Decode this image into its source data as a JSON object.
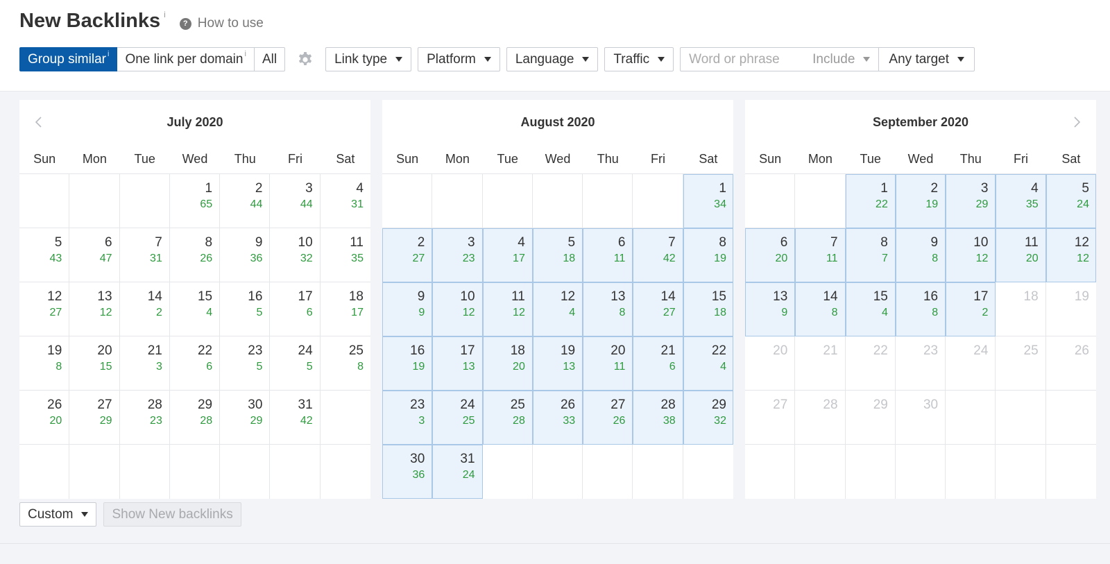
{
  "header": {
    "title": "New Backlinks",
    "title_info": "i",
    "how_to_icon": "question-circle-icon",
    "how_to_label": "How to use"
  },
  "toolbar": {
    "grouping": [
      {
        "label": "Group similar",
        "info": "i",
        "active": true
      },
      {
        "label": "One link per domain",
        "info": "i",
        "active": false
      },
      {
        "label": "All",
        "info": "",
        "active": false
      }
    ],
    "settings_icon": "gear-icon",
    "filters": [
      "Link type",
      "Platform",
      "Language",
      "Traffic"
    ],
    "search_placeholder": "Word or phrase",
    "include_label": "Include",
    "target_label": "Any target"
  },
  "weekdays": [
    "Sun",
    "Mon",
    "Tue",
    "Wed",
    "Thu",
    "Fri",
    "Sat"
  ],
  "calendars": [
    {
      "month": "July 2020",
      "nav": "prev",
      "weeks": [
        [
          null,
          null,
          null,
          {
            "d": "1",
            "c": "65"
          },
          {
            "d": "2",
            "c": "44"
          },
          {
            "d": "3",
            "c": "44"
          },
          {
            "d": "4",
            "c": "31"
          }
        ],
        [
          {
            "d": "5",
            "c": "43"
          },
          {
            "d": "6",
            "c": "47"
          },
          {
            "d": "7",
            "c": "31"
          },
          {
            "d": "8",
            "c": "26"
          },
          {
            "d": "9",
            "c": "36"
          },
          {
            "d": "10",
            "c": "32"
          },
          {
            "d": "11",
            "c": "35"
          }
        ],
        [
          {
            "d": "12",
            "c": "27"
          },
          {
            "d": "13",
            "c": "12"
          },
          {
            "d": "14",
            "c": "2"
          },
          {
            "d": "15",
            "c": "4"
          },
          {
            "d": "16",
            "c": "5"
          },
          {
            "d": "17",
            "c": "6"
          },
          {
            "d": "18",
            "c": "17"
          }
        ],
        [
          {
            "d": "19",
            "c": "8"
          },
          {
            "d": "20",
            "c": "15"
          },
          {
            "d": "21",
            "c": "3"
          },
          {
            "d": "22",
            "c": "6"
          },
          {
            "d": "23",
            "c": "5"
          },
          {
            "d": "24",
            "c": "5"
          },
          {
            "d": "25",
            "c": "8"
          }
        ],
        [
          {
            "d": "26",
            "c": "20"
          },
          {
            "d": "27",
            "c": "29"
          },
          {
            "d": "28",
            "c": "23"
          },
          {
            "d": "29",
            "c": "28"
          },
          {
            "d": "30",
            "c": "29"
          },
          {
            "d": "31",
            "c": "42"
          },
          null
        ],
        [
          null,
          null,
          null,
          null,
          null,
          null,
          null
        ]
      ]
    },
    {
      "month": "August 2020",
      "nav": "",
      "weeks": [
        [
          null,
          null,
          null,
          null,
          null,
          null,
          {
            "d": "1",
            "c": "34",
            "s": true
          }
        ],
        [
          {
            "d": "2",
            "c": "27",
            "s": true
          },
          {
            "d": "3",
            "c": "23",
            "s": true
          },
          {
            "d": "4",
            "c": "17",
            "s": true
          },
          {
            "d": "5",
            "c": "18",
            "s": true
          },
          {
            "d": "6",
            "c": "11",
            "s": true
          },
          {
            "d": "7",
            "c": "42",
            "s": true
          },
          {
            "d": "8",
            "c": "19",
            "s": true
          }
        ],
        [
          {
            "d": "9",
            "c": "9",
            "s": true
          },
          {
            "d": "10",
            "c": "12",
            "s": true
          },
          {
            "d": "11",
            "c": "12",
            "s": true
          },
          {
            "d": "12",
            "c": "4",
            "s": true
          },
          {
            "d": "13",
            "c": "8",
            "s": true
          },
          {
            "d": "14",
            "c": "27",
            "s": true
          },
          {
            "d": "15",
            "c": "18",
            "s": true
          }
        ],
        [
          {
            "d": "16",
            "c": "19",
            "s": true
          },
          {
            "d": "17",
            "c": "13",
            "s": true
          },
          {
            "d": "18",
            "c": "20",
            "s": true
          },
          {
            "d": "19",
            "c": "13",
            "s": true
          },
          {
            "d": "20",
            "c": "11",
            "s": true
          },
          {
            "d": "21",
            "c": "6",
            "s": true
          },
          {
            "d": "22",
            "c": "4",
            "s": true
          }
        ],
        [
          {
            "d": "23",
            "c": "3",
            "s": true
          },
          {
            "d": "24",
            "c": "25",
            "s": true
          },
          {
            "d": "25",
            "c": "28",
            "s": true
          },
          {
            "d": "26",
            "c": "33",
            "s": true
          },
          {
            "d": "27",
            "c": "26",
            "s": true
          },
          {
            "d": "28",
            "c": "38",
            "s": true
          },
          {
            "d": "29",
            "c": "32",
            "s": true
          }
        ],
        [
          {
            "d": "30",
            "c": "36",
            "s": true
          },
          {
            "d": "31",
            "c": "24",
            "s": true
          },
          null,
          null,
          null,
          null,
          null
        ]
      ]
    },
    {
      "month": "September 2020",
      "nav": "next",
      "weeks": [
        [
          null,
          null,
          {
            "d": "1",
            "c": "22",
            "s": true
          },
          {
            "d": "2",
            "c": "19",
            "s": true
          },
          {
            "d": "3",
            "c": "29",
            "s": true
          },
          {
            "d": "4",
            "c": "35",
            "s": true
          },
          {
            "d": "5",
            "c": "24",
            "s": true
          }
        ],
        [
          {
            "d": "6",
            "c": "20",
            "s": true
          },
          {
            "d": "7",
            "c": "11",
            "s": true
          },
          {
            "d": "8",
            "c": "7",
            "s": true
          },
          {
            "d": "9",
            "c": "8",
            "s": true
          },
          {
            "d": "10",
            "c": "12",
            "s": true
          },
          {
            "d": "11",
            "c": "20",
            "s": true
          },
          {
            "d": "12",
            "c": "12",
            "s": true
          }
        ],
        [
          {
            "d": "13",
            "c": "9",
            "s": true
          },
          {
            "d": "14",
            "c": "8",
            "s": true
          },
          {
            "d": "15",
            "c": "4",
            "s": true
          },
          {
            "d": "16",
            "c": "8",
            "s": true
          },
          {
            "d": "17",
            "c": "2",
            "s": true
          },
          {
            "d": "18",
            "m": true
          },
          {
            "d": "19",
            "m": true
          }
        ],
        [
          {
            "d": "20",
            "m": true
          },
          {
            "d": "21",
            "m": true
          },
          {
            "d": "22",
            "m": true
          },
          {
            "d": "23",
            "m": true
          },
          {
            "d": "24",
            "m": true
          },
          {
            "d": "25",
            "m": true
          },
          {
            "d": "26",
            "m": true
          }
        ],
        [
          {
            "d": "27",
            "m": true
          },
          {
            "d": "28",
            "m": true
          },
          {
            "d": "29",
            "m": true
          },
          {
            "d": "30",
            "m": true
          },
          null,
          null,
          null
        ],
        [
          null,
          null,
          null,
          null,
          null,
          null,
          null
        ]
      ]
    }
  ],
  "footer": {
    "period_label": "Custom",
    "show_button": "Show New backlinks"
  },
  "colors": {
    "accent": "#0b5ca8",
    "count_green": "#2e9a3e",
    "selected_bg": "#eaf2fb",
    "selected_border": "#a9c8e8"
  }
}
